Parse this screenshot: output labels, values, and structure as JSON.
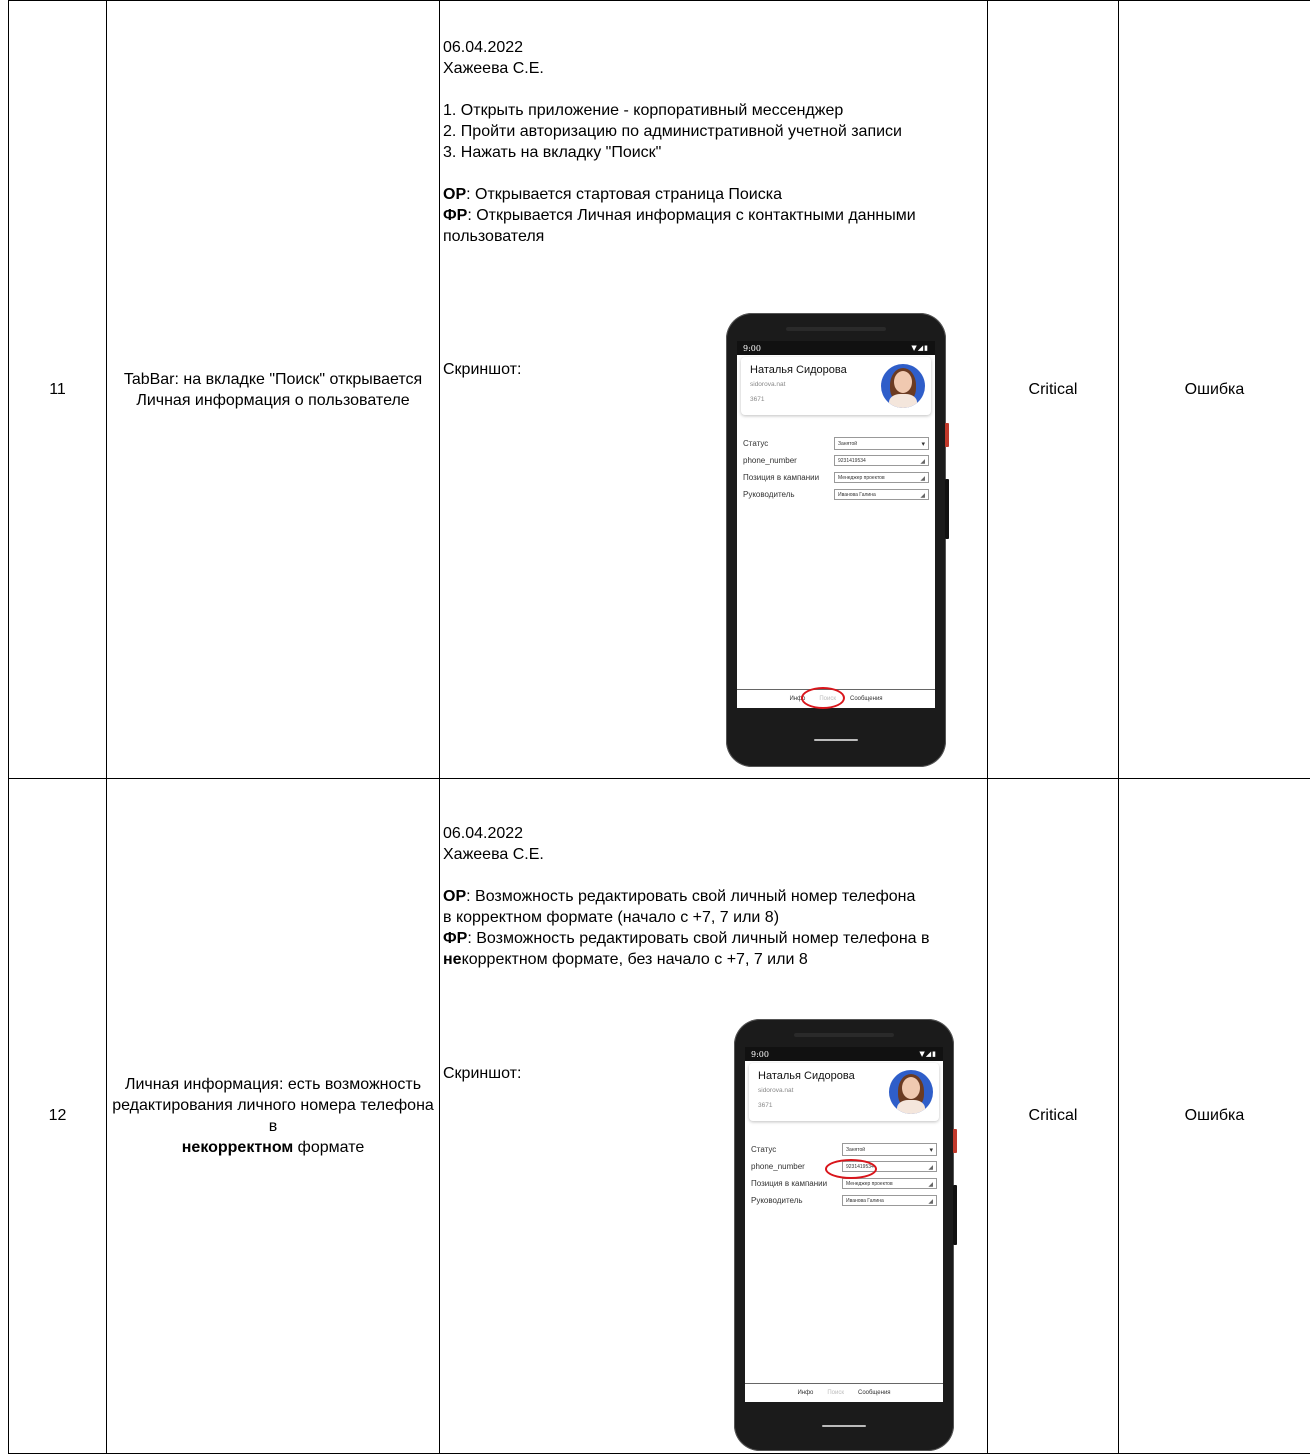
{
  "rows": [
    {
      "num": "11",
      "summary": "TabBar: на вкладке \"Поиск\" открывается Личная информация о пользователе",
      "date": "06.04.2022",
      "author": "Хажеева С.Е.",
      "step1": "1. Открыть приложение - корпоративный мессенджер",
      "step2": "2. Пройти авторизацию по административной учетной записи",
      "step3": "3. Нажать на вкладку \"Поиск\"",
      "expected_label": "ОР",
      "expected": ": Открывается стартовая страница Поиска",
      "actual_label": "ФР",
      "actual": ": Открывается Личная информация с контактными данными пользователя",
      "screenshot_label": "Скриншот:",
      "severity": "Critical",
      "type": "Ошибка"
    },
    {
      "num": "12",
      "summary_a": "Личная информация: есть возможность редактирования личного номера телефона в",
      "summary_bold": "некорректном",
      "summary_b": " формате",
      "date": "06.04.2022",
      "author": "Хажеева С.Е.",
      "expected_label": "ОР",
      "expected": ": Возможность редактировать свой личный номер телефона в корректном формате (начало с +7, 7 или 8)",
      "actual_label": "ФР",
      "actual_a": ": Возможность редактировать свой личный номер телефона в ",
      "actual_bold": "не",
      "actual_b": "корректном формате, без начало с +7, 7 или 8",
      "screenshot_label": "Скриншот:",
      "severity": "Critical",
      "type": "Ошибка"
    }
  ],
  "phone": {
    "time": "9:00",
    "status_icons": "▼◢▮",
    "name": "Наталья Сидорова",
    "login": "sidorova.nat",
    "ext": "3671",
    "fields": [
      {
        "label": "Статус",
        "value": "Занятой"
      },
      {
        "label": "phone_number",
        "value": "9231419534"
      },
      {
        "label": "Позиция в кампании",
        "value": "Менеджер проектов"
      },
      {
        "label": "Руководитель",
        "value": "Иванова Галина"
      }
    ],
    "tabs": [
      "Инфо",
      "Поиск",
      "Сообщения"
    ]
  }
}
